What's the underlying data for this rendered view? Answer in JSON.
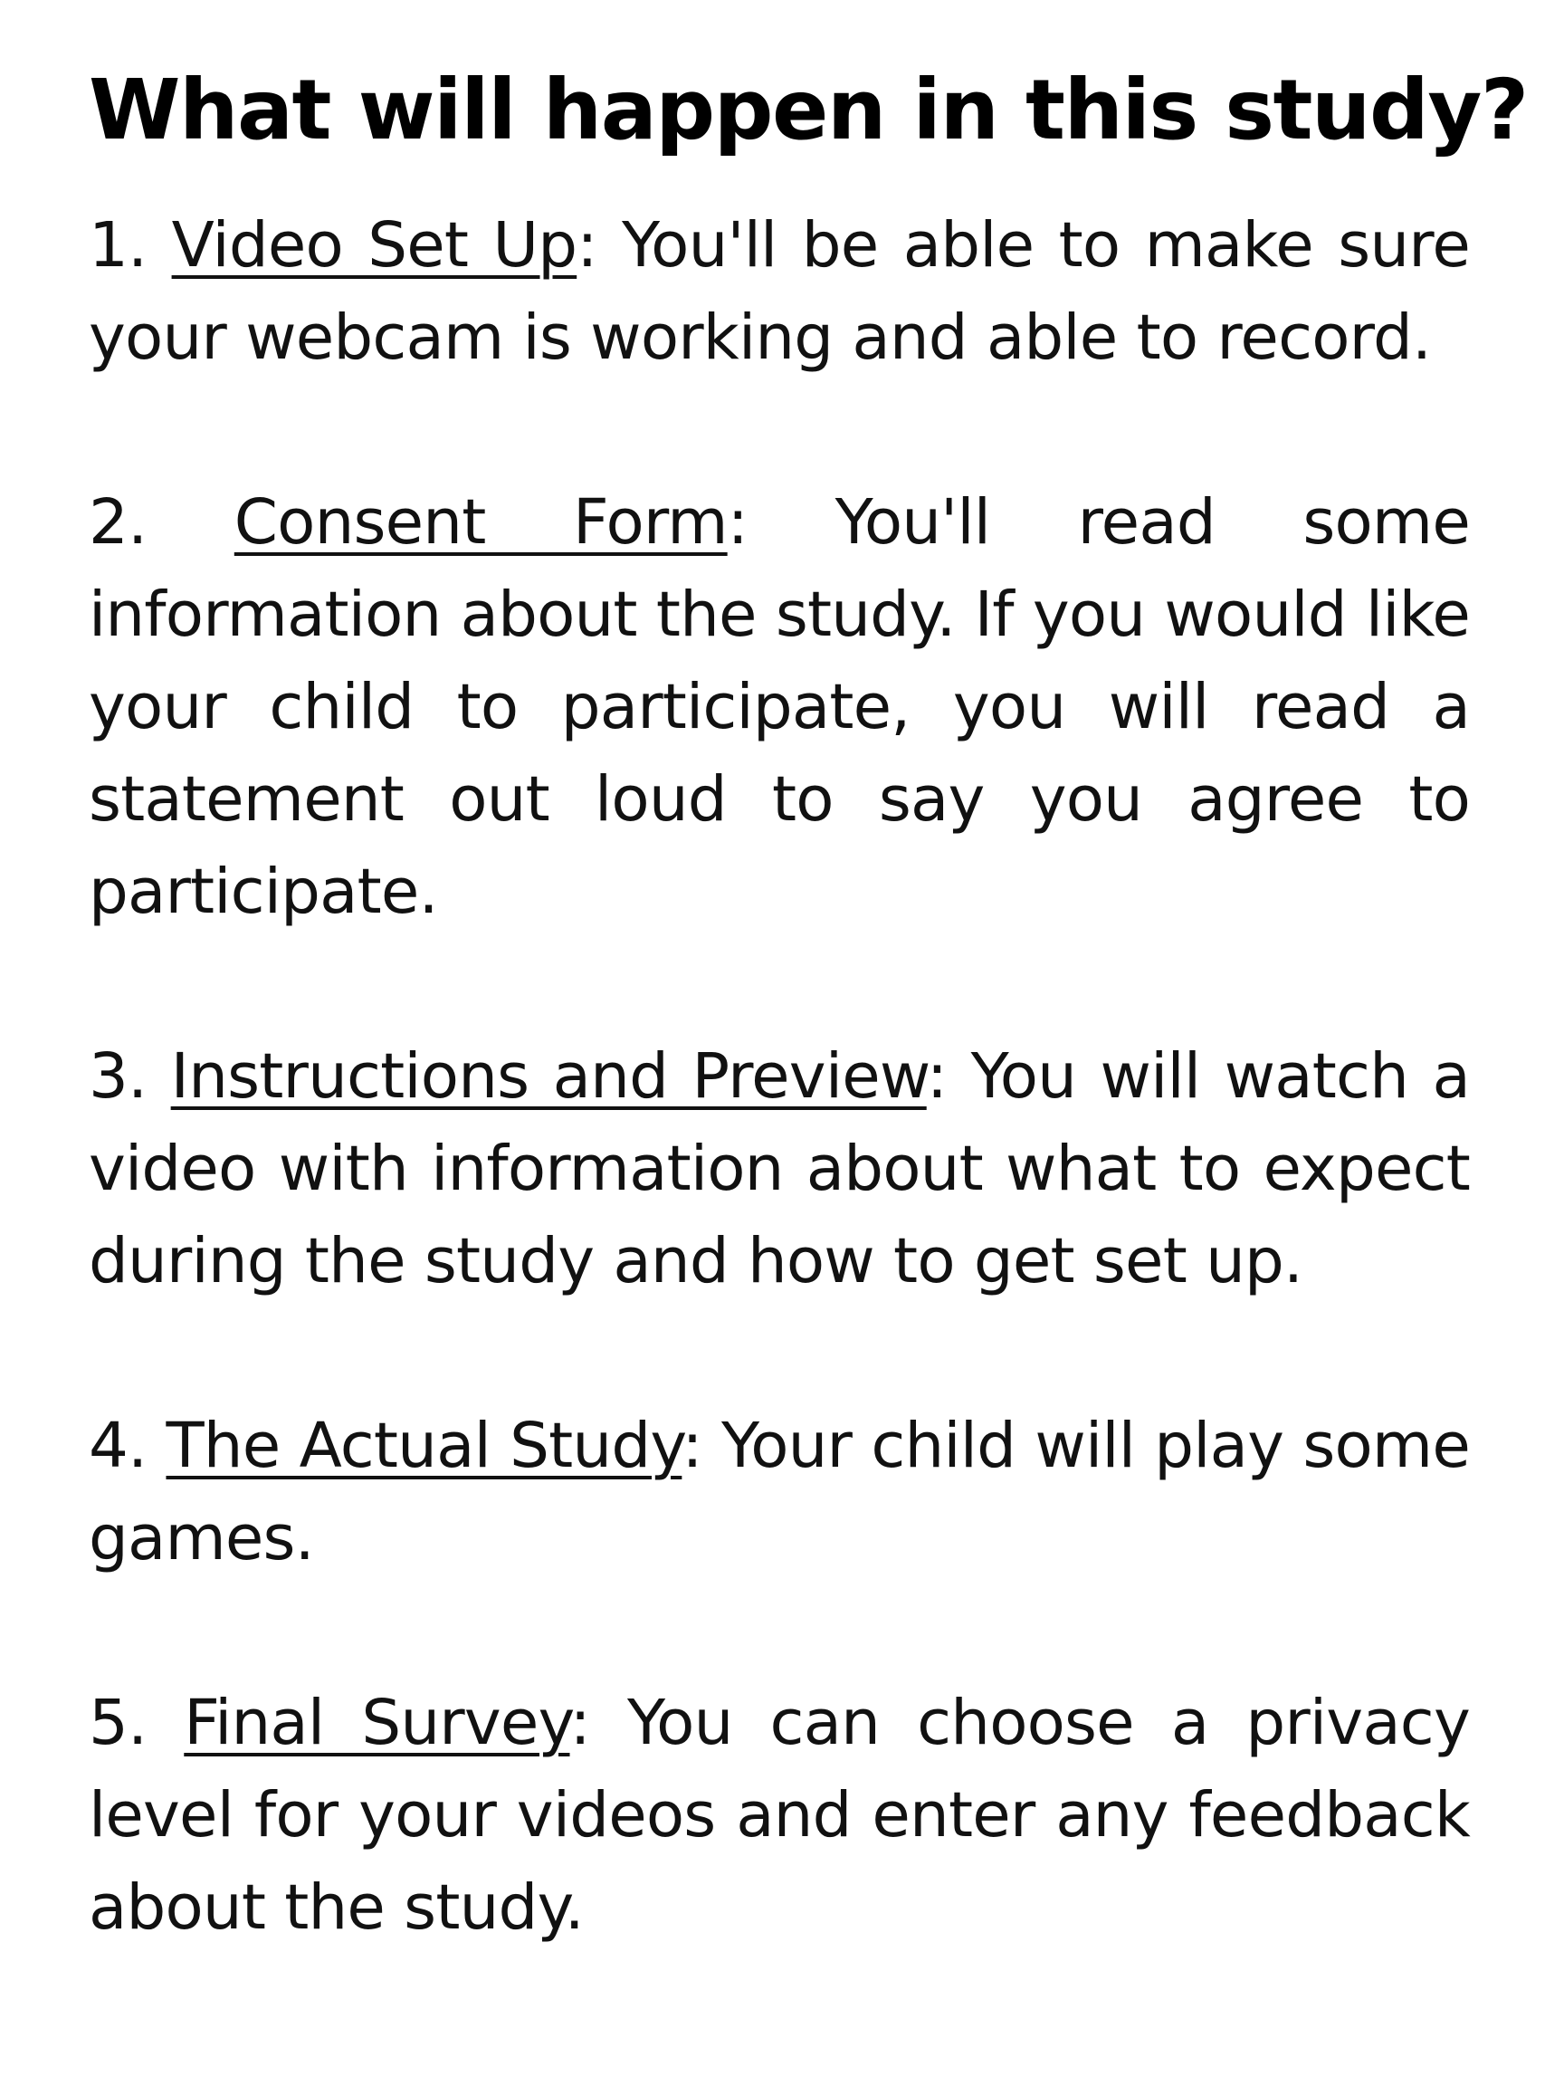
{
  "page": {
    "title": "What will happen in this study?"
  },
  "steps": [
    {
      "number": "1.",
      "label": "Video Set Up",
      "text": ": You'll be able to make sure your webcam is working and able to record."
    },
    {
      "number": "2.",
      "label": "Consent Form",
      "text": ": You'll read some information about the study. If you would like your child to participate, you will read a statement out loud to say you agree to participate."
    },
    {
      "number": "3.",
      "label": "Instructions and Preview",
      "text": ": You will watch a video with information about what to expect during the study and how to get set up."
    },
    {
      "number": "4.",
      "label": "The Actual Study",
      "text": ": Your child will play some games."
    },
    {
      "number": "5.",
      "label": "Final Survey",
      "text": ": You can choose a privacy level for your videos and enter any feedback about the study."
    }
  ]
}
